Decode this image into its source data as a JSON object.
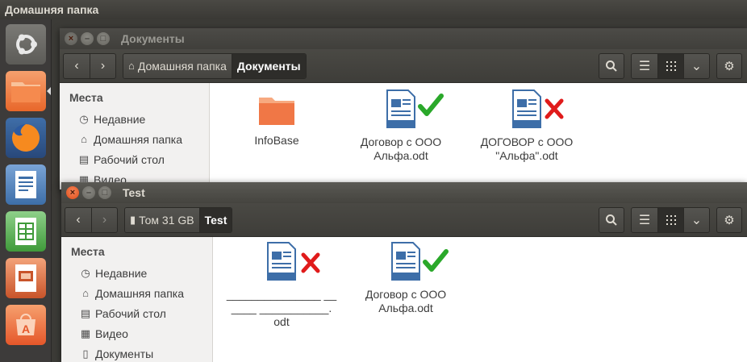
{
  "top_panel": {
    "title": "Домашняя папка"
  },
  "launcher": {
    "items": [
      {
        "name": "ubuntu-dash"
      },
      {
        "name": "files",
        "active": true
      },
      {
        "name": "firefox"
      },
      {
        "name": "libreoffice-writer"
      },
      {
        "name": "libreoffice-calc"
      },
      {
        "name": "libreoffice-impress"
      },
      {
        "name": "ubuntu-software"
      }
    ]
  },
  "window_back": {
    "title": "Документы",
    "breadcrumbs": [
      {
        "label": "Домашняя папка",
        "icon": "home-icon"
      },
      {
        "label": "Документы",
        "active": true
      }
    ],
    "sidebar": {
      "heading": "Места",
      "items": [
        {
          "label": "Недавние",
          "icon": "clock-icon"
        },
        {
          "label": "Домашняя папка",
          "icon": "home-icon"
        },
        {
          "label": "Рабочий стол",
          "icon": "folder-icon"
        },
        {
          "label": "Видео",
          "icon": "film-icon"
        }
      ]
    },
    "files": [
      {
        "label": "InfoBase",
        "type": "folder"
      },
      {
        "label": "Договор с ООО Альфа.odt",
        "type": "odt",
        "mark": "check"
      },
      {
        "label": "ДОГОВОР с ООО \"Альфа\".odt",
        "type": "odt",
        "mark": "cross"
      }
    ]
  },
  "window_front": {
    "title": "Test",
    "breadcrumbs": [
      {
        "label": "Том 31 GB",
        "icon": "usb-drive-icon"
      },
      {
        "label": "Test",
        "active": true
      }
    ],
    "sidebar": {
      "heading": "Места",
      "items": [
        {
          "label": "Недавние",
          "icon": "clock-icon"
        },
        {
          "label": "Домашняя папка",
          "icon": "home-icon"
        },
        {
          "label": "Рабочий стол",
          "icon": "folder-icon"
        },
        {
          "label": "Видео",
          "icon": "film-icon"
        },
        {
          "label": "Документы",
          "icon": "document-icon"
        }
      ]
    },
    "files": [
      {
        "label_line1": "_______________ __",
        "label_line2": "____ ___________.",
        "label_line3": "odt",
        "type": "odt",
        "mark": "cross"
      },
      {
        "label": "Договор с ООО Альфа.odt",
        "type": "odt",
        "mark": "check"
      }
    ]
  },
  "colors": {
    "accent": "#f07746",
    "check": "#2aa82a",
    "cross": "#e01b1b",
    "panel": "#3c3b37"
  }
}
